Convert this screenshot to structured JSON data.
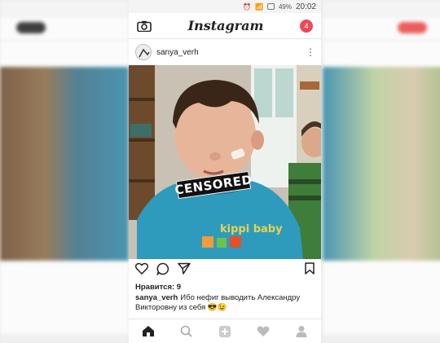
{
  "statusbar": {
    "battery": "49%",
    "time": "20:02"
  },
  "appbar": {
    "camera_icon": "camera-icon",
    "title": "Instagram",
    "notifications_count": "4"
  },
  "post": {
    "username": "sanya_verh",
    "more_icon": "more-vertical-icon",
    "image_overlay_text": "CENSORED",
    "likes_text": "Нравится: 9",
    "caption_user": "sanya_verh",
    "caption_text": "Ибо нефиг выводить Александру Викторовну из себя 😎😉",
    "shirt_print": "kippi baby"
  },
  "actions": {
    "like_icon": "heart-icon",
    "comment_icon": "comment-icon",
    "share_icon": "send-icon",
    "bookmark_icon": "bookmark-icon"
  },
  "bottomnav": {
    "items": [
      "home-icon",
      "search-icon",
      "add-icon",
      "heart-icon",
      "profile-icon"
    ]
  },
  "colors": {
    "accent_red": "#ed4956",
    "text": "#222222"
  }
}
